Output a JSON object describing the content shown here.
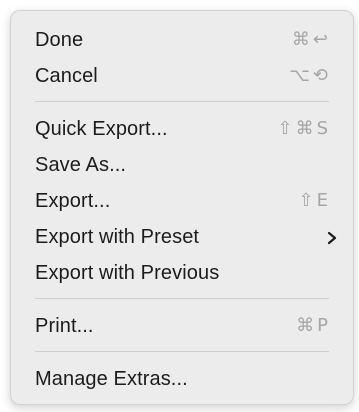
{
  "menu": {
    "groups": [
      {
        "items": [
          {
            "label": "Done",
            "shortcut": "⌘↩"
          },
          {
            "label": "Cancel",
            "shortcut": "⌥⟲"
          }
        ]
      },
      {
        "items": [
          {
            "label": "Quick Export...",
            "shortcut": "⇧⌘S"
          },
          {
            "label": "Save As...",
            "shortcut": ""
          },
          {
            "label": "Export...",
            "shortcut": "⇧E"
          },
          {
            "label": "Export with Preset",
            "shortcut": "",
            "submenu_icon": "chevron-right-icon"
          },
          {
            "label": "Export with Previous",
            "shortcut": ""
          }
        ]
      },
      {
        "items": [
          {
            "label": "Print...",
            "shortcut": "⌘P"
          }
        ]
      },
      {
        "items": [
          {
            "label": "Manage Extras...",
            "shortcut": ""
          }
        ]
      }
    ]
  }
}
